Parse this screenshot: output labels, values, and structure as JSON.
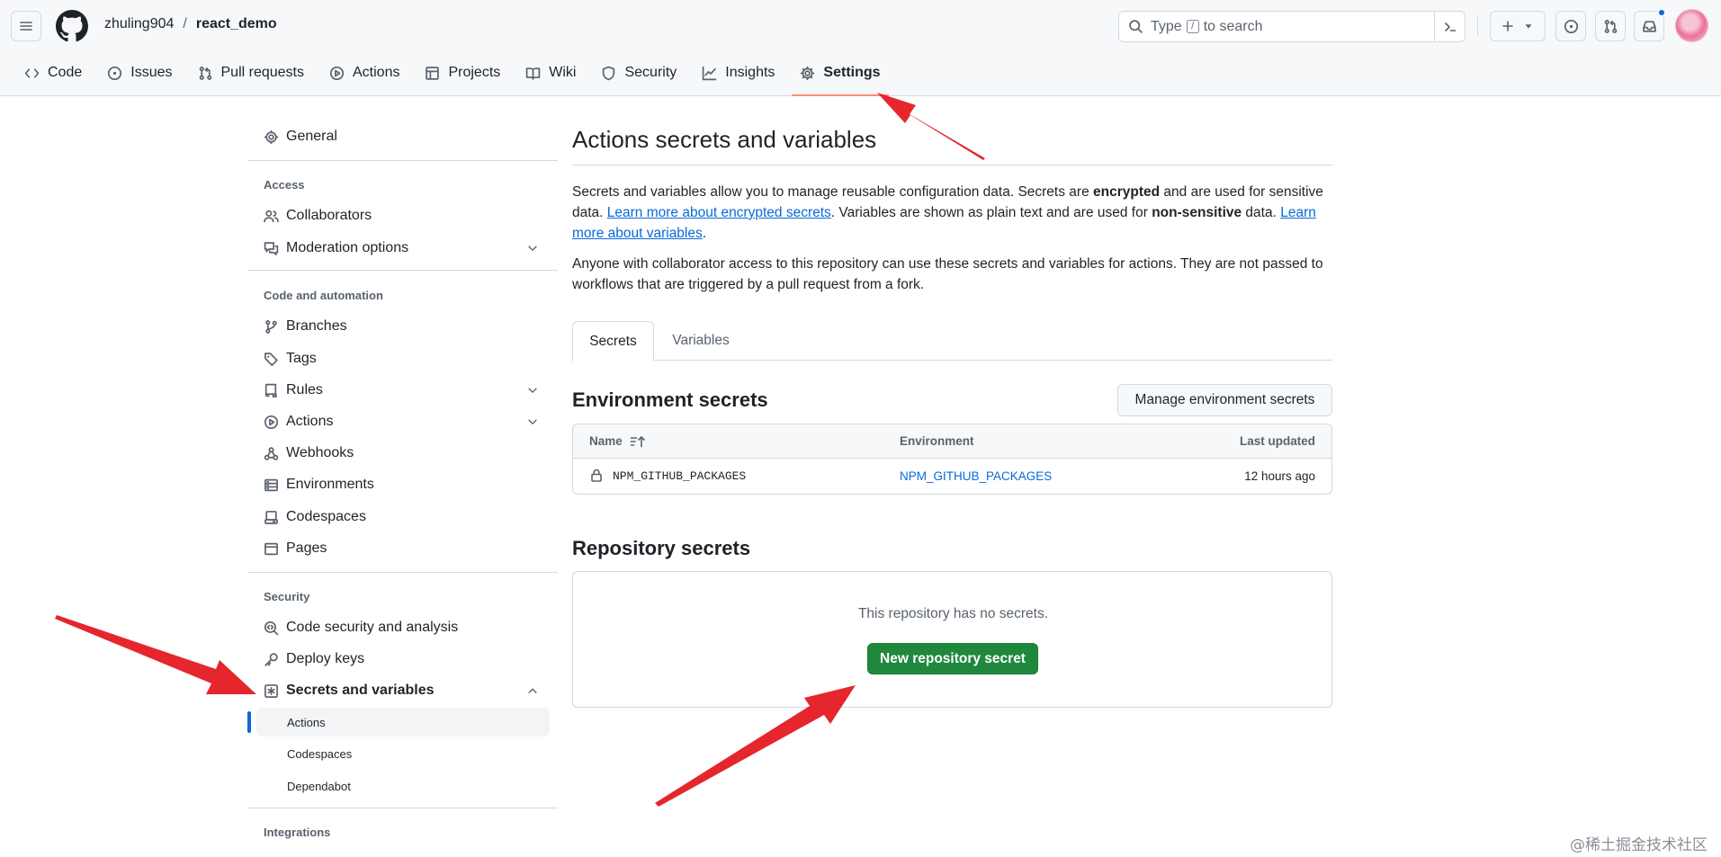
{
  "header": {
    "owner": "zhuling904",
    "separator": "/",
    "repo": "react_demo",
    "search_prefix": "Type",
    "search_key": "/",
    "search_suffix": "to search",
    "notification_dot_color": "#0969da"
  },
  "repo_tabs": [
    {
      "label": "Code",
      "icon": "code-icon"
    },
    {
      "label": "Issues",
      "icon": "issue-icon"
    },
    {
      "label": "Pull requests",
      "icon": "pull-request-icon"
    },
    {
      "label": "Actions",
      "icon": "play-icon"
    },
    {
      "label": "Projects",
      "icon": "table-icon"
    },
    {
      "label": "Wiki",
      "icon": "book-icon"
    },
    {
      "label": "Security",
      "icon": "shield-icon"
    },
    {
      "label": "Insights",
      "icon": "graph-icon"
    },
    {
      "label": "Settings",
      "icon": "gear-icon",
      "active": true
    }
  ],
  "sidebar": {
    "general": "General",
    "access_heading": "Access",
    "collaborators": "Collaborators",
    "moderation": "Moderation options",
    "code_heading": "Code and automation",
    "branches": "Branches",
    "tags": "Tags",
    "rules": "Rules",
    "actions": "Actions",
    "webhooks": "Webhooks",
    "environments": "Environments",
    "codespaces": "Codespaces",
    "pages": "Pages",
    "security_heading": "Security",
    "code_security": "Code security and analysis",
    "deploy_keys": "Deploy keys",
    "secrets_vars": "Secrets and variables",
    "sub_actions": "Actions",
    "sub_codespaces": "Codespaces",
    "sub_dependabot": "Dependabot",
    "integrations_heading": "Integrations"
  },
  "main": {
    "title": "Actions secrets and variables",
    "p1_a": "Secrets and variables allow you to manage reusable configuration data. Secrets are ",
    "p1_b": "encrypted",
    "p1_c": " and are used for sensitive data. ",
    "p1_link1": "Learn more about encrypted secrets",
    "p1_d": ". Variables are shown as plain text and are used for ",
    "p1_e": "non-sensitive",
    "p1_f": " data. ",
    "p1_link2": "Learn more about variables",
    "p1_g": ".",
    "p2": "Anyone with collaborator access to this repository can use these secrets and variables for actions. They are not passed to workflows that are triggered by a pull request from a fork.",
    "tab_secrets": "Secrets",
    "tab_variables": "Variables",
    "env_title": "Environment secrets",
    "manage_env_btn": "Manage environment secrets",
    "col_name": "Name",
    "col_env": "Environment",
    "col_updated": "Last updated",
    "rows": [
      {
        "name": "NPM_GITHUB_PACKAGES",
        "environment": "NPM_GITHUB_PACKAGES",
        "updated": "12 hours ago"
      }
    ],
    "repo_title": "Repository secrets",
    "empty_msg": "This repository has no secrets.",
    "new_secret_btn": "New repository secret"
  },
  "colors": {
    "primary_button": "#1f883d",
    "link": "#0969da",
    "active_tab_underline": "#fd8c73",
    "annotation_arrow": "#e5262d"
  },
  "watermark": "@稀土掘金技术社区"
}
